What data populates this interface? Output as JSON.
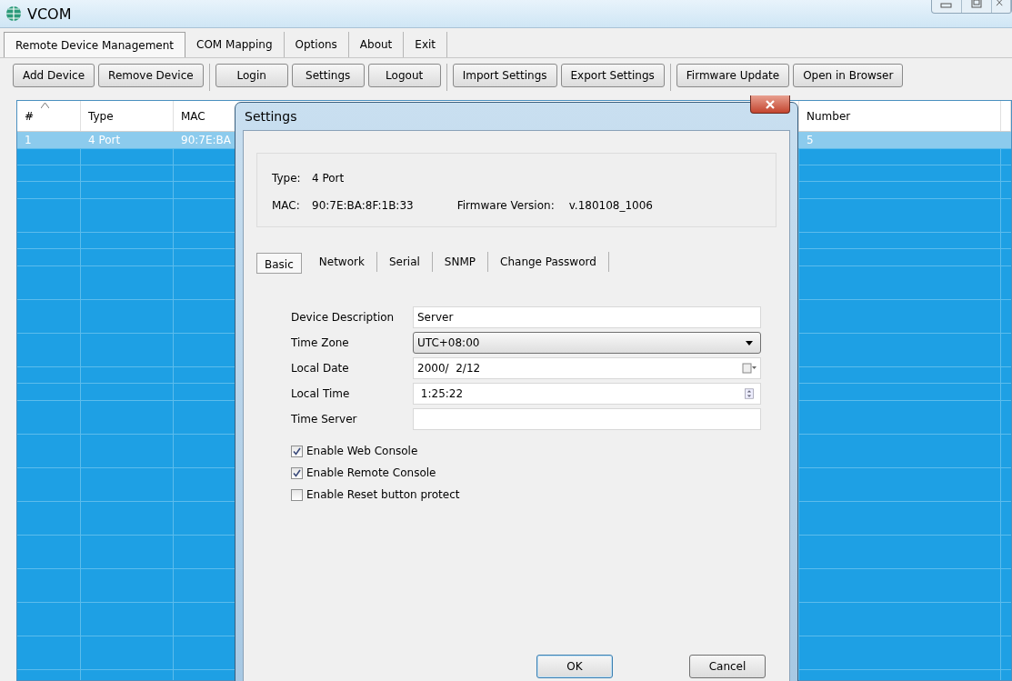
{
  "window": {
    "title": "VCOM"
  },
  "menu": [
    {
      "label": "Remote Device Management",
      "selected": true
    },
    {
      "label": "COM Mapping",
      "selected": false
    },
    {
      "label": "Options",
      "selected": false
    },
    {
      "label": "About",
      "selected": false
    },
    {
      "label": "Exit",
      "selected": false
    }
  ],
  "toolbar": [
    [
      "Add Device",
      "Remove Device"
    ],
    [
      "Login",
      "Settings",
      "Logout"
    ],
    [
      "Import Settings",
      "Export Settings"
    ],
    [
      "Firmware Update",
      "Open in Browser"
    ]
  ],
  "table": {
    "columns": [
      {
        "label": "#",
        "sorted": true
      },
      {
        "label": "Type",
        "sorted": false
      },
      {
        "label": "MAC",
        "sorted": false
      },
      {
        "label": "Number",
        "sorted": false
      }
    ],
    "rows": [
      {
        "cells": [
          "1",
          "4 Port",
          "90:7E:BA",
          "5"
        ],
        "selected": true
      }
    ]
  },
  "dialog": {
    "title": "Settings",
    "info": {
      "type_label": "Type:",
      "type": "4 Port",
      "mac_label": "MAC:",
      "mac": "90:7E:BA:8F:1B:33",
      "firmware_label": "Firmware Version:",
      "firmware": "v.180108_1006"
    },
    "tabs": [
      {
        "label": "Basic",
        "selected": true
      },
      {
        "label": "Network",
        "selected": false
      },
      {
        "label": "Serial",
        "selected": false
      },
      {
        "label": "SNMP",
        "selected": false
      },
      {
        "label": "Change Password",
        "selected": false
      }
    ],
    "fields": [
      {
        "kind": "text",
        "label": "Device Description",
        "value": "Server"
      },
      {
        "kind": "dropdown",
        "label": "Time Zone",
        "value": "UTC+08:00"
      },
      {
        "kind": "date",
        "label": "Local Date",
        "value": "2000/  2/12"
      },
      {
        "kind": "spin",
        "label": "Local Time",
        "value": " 1:25:22"
      },
      {
        "kind": "text",
        "label": "Time Server"
      }
    ],
    "checkboxes": [
      {
        "label": "Enable Web Console",
        "checked": true
      },
      {
        "label": "Enable Remote Console",
        "checked": true
      },
      {
        "label": "Enable Reset button protect",
        "checked": false
      }
    ],
    "buttons": [
      {
        "label": "OK",
        "default": true
      },
      {
        "label": "Cancel",
        "default": false
      }
    ]
  }
}
